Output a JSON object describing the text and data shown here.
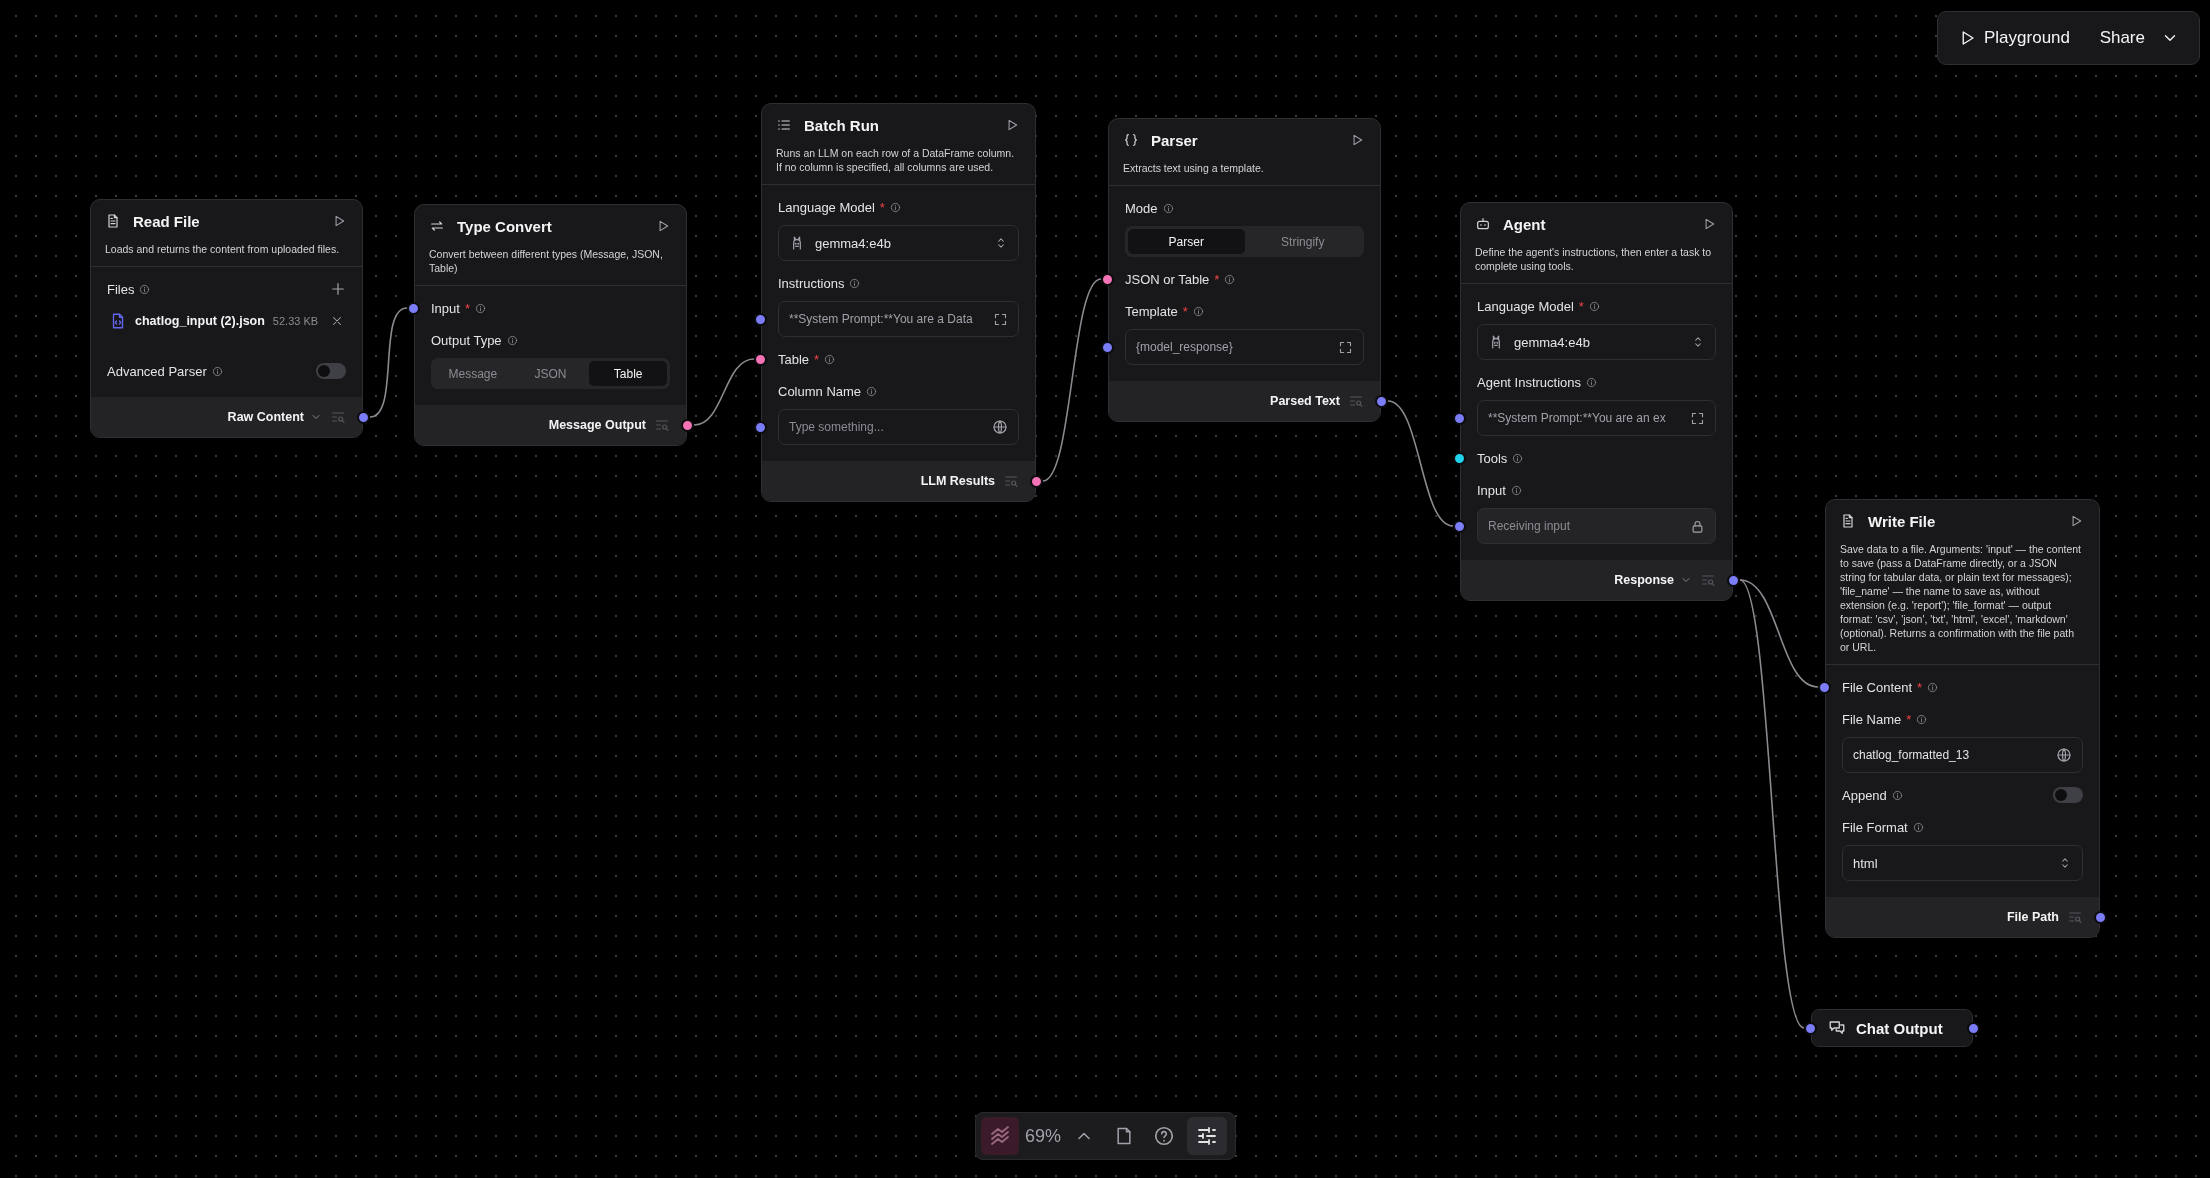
{
  "top_bar": {
    "playground": "Playground",
    "share": "Share"
  },
  "nodes": [
    {
      "kind": "full",
      "title": "Read File",
      "description": "Loads and returns the content from uploaded files.",
      "fields": [
        {
          "kind": "files",
          "label": "Files",
          "files": [
            {
              "name": "chatlog_input (2).json",
              "size": "52.33 KB"
            }
          ]
        },
        {
          "kind": "toggle",
          "label": "Advanced Parser",
          "on": false
        }
      ],
      "output": {
        "label": "Raw Content",
        "dropdown": true,
        "color": "#7b7cf8"
      }
    },
    {
      "kind": "full",
      "title": "Type Convert",
      "description": "Convert between different types (Message, JSON, Table)",
      "fields": [
        {
          "kind": "label",
          "label": "Input",
          "required_mark": "*",
          "color": "#7b7cf8"
        },
        {
          "kind": "segmented",
          "label": "Output Type",
          "options": [
            {
              "label": "Message",
              "selected": false
            },
            {
              "label": "JSON",
              "selected": false
            },
            {
              "label": "Table",
              "selected": true
            }
          ]
        }
      ],
      "output": {
        "label": "Message Output",
        "dropdown": false,
        "color": "#f472b6"
      }
    },
    {
      "kind": "full",
      "title": "Batch Run",
      "description": "Runs an LLM on each row of a DataFrame column. If no column is specified, all columns are used.",
      "fields": [
        {
          "kind": "model-select",
          "label": "Language Model",
          "required_mark": "*",
          "value": "gemma4:e4b"
        },
        {
          "kind": "textarea",
          "label": "Instructions",
          "value": "**System Prompt:**You are a Data",
          "color": "#7b7cf8"
        },
        {
          "kind": "label",
          "label": "Table",
          "required_mark": "*",
          "color": "#f472b6"
        },
        {
          "kind": "text",
          "label": "Column Name",
          "placeholder": "Type something...",
          "color": "#7b7cf8"
        }
      ],
      "output": {
        "label": "LLM Results",
        "dropdown": false,
        "color": "#f472b6"
      }
    },
    {
      "kind": "full",
      "title": "Parser",
      "description": "Extracts text using a template.",
      "fields": [
        {
          "kind": "segmented",
          "label": "Mode",
          "options": [
            {
              "label": "Parser",
              "selected": true
            },
            {
              "label": "Stringify",
              "selected": false
            }
          ]
        },
        {
          "kind": "label",
          "label": "JSON or Table",
          "required_mark": "*",
          "color": "#f472b6"
        },
        {
          "kind": "textarea",
          "label": "Template",
          "required_mark": "*",
          "value": "{model_response}",
          "color": "#7b7cf8"
        }
      ],
      "output": {
        "label": "Parsed Text",
        "dropdown": false,
        "color": "#7b7cf8"
      }
    },
    {
      "kind": "full",
      "title": "Agent",
      "description": "Define the agent's instructions, then enter a task to complete using tools.",
      "fields": [
        {
          "kind": "model-select",
          "label": "Language Model",
          "required_mark": "*",
          "value": "gemma4:e4b"
        },
        {
          "kind": "textarea",
          "label": "Agent Instructions",
          "value": "**System Prompt:**You are an ex",
          "color": "#7b7cf8"
        },
        {
          "kind": "label",
          "label": "Tools",
          "color": "#22d3ee"
        },
        {
          "kind": "locked",
          "label": "Input",
          "placeholder": "Receiving input",
          "color": "#7b7cf8"
        }
      ],
      "output": {
        "label": "Response",
        "dropdown": true,
        "color": "#7b7cf8"
      }
    },
    {
      "kind": "full",
      "title": "Write File",
      "description": "Save data to a file. Arguments: 'input' — the content to save (pass a DataFrame directly, or a JSON string for tabular data, or plain text for messages); 'file_name' — the name to save as, without extension (e.g. 'report'); 'file_format' — output format: 'csv', 'json', 'txt', 'html', 'excel', 'markdown' (optional). Returns a confirmation with the file path or URL.",
      "fields": [
        {
          "kind": "label",
          "label": "File Content",
          "required_mark": "*",
          "color": "#7b7cf8"
        },
        {
          "kind": "text",
          "label": "File Name",
          "required_mark": "*",
          "value": "chatlog_formatted_13"
        },
        {
          "kind": "toggle",
          "label": "Append",
          "on": false
        },
        {
          "kind": "select",
          "label": "File Format",
          "value": "html"
        }
      ],
      "output": {
        "label": "File Path",
        "dropdown": false,
        "color": "#7b7cf8"
      }
    },
    {
      "kind": "compact",
      "title": "Chat Output",
      "input": {
        "color": "#7b7cf8"
      },
      "output": {
        "color": "#7b7cf8"
      }
    }
  ],
  "toolbar": {
    "zoom": "69%"
  }
}
